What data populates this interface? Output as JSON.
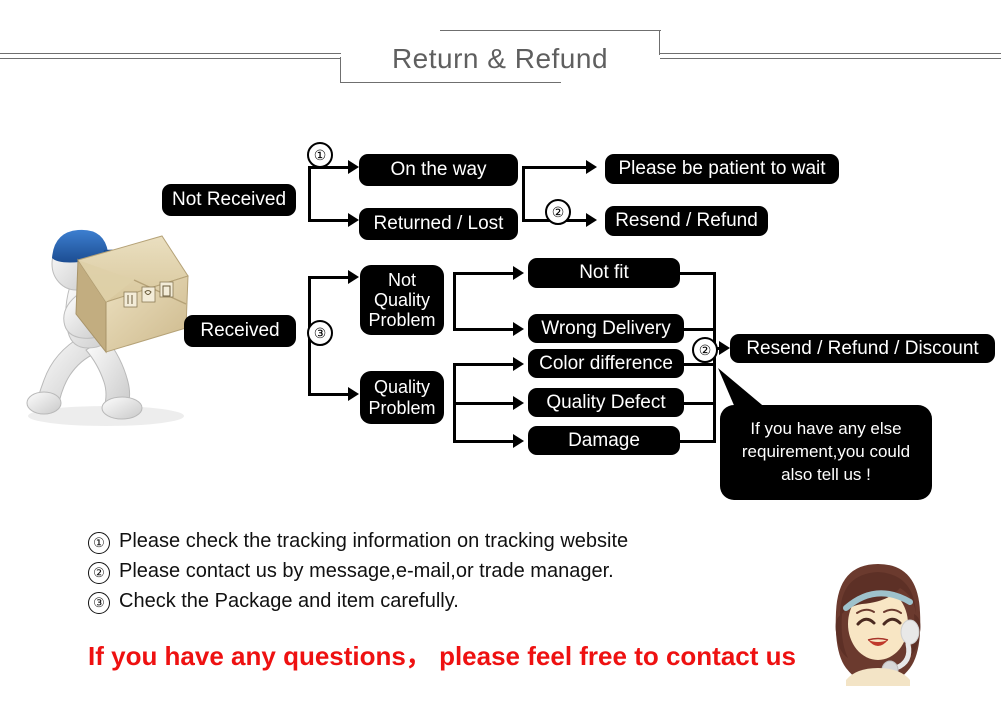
{
  "header": {
    "title": "Return & Refund"
  },
  "flow": {
    "not_received": "Not Received",
    "on_the_way": "On the way",
    "returned_lost": "Returned / Lost",
    "please_wait": "Please be patient to wait",
    "resend_refund": "Resend / Refund",
    "received": "Received",
    "not_quality_problem": "Not\nQuality\nProblem",
    "quality_problem": "Quality\nProblem",
    "not_fit": "Not fit",
    "wrong_delivery": "Wrong Delivery",
    "color_difference": "Color difference",
    "quality_defect": "Quality Defect",
    "damage": "Damage",
    "final_outcome": "Resend / Refund / Discount",
    "bubble": "If you have any else requirement,you could also tell us !",
    "marker_1": "①",
    "marker_2": "②",
    "marker_3": "③",
    "marker_2b": "②",
    "marker_2c": "②"
  },
  "notes": [
    {
      "num": "①",
      "text": "Please check the tracking information on tracking website"
    },
    {
      "num": "②",
      "text": "Please contact us by message,e-mail,or trade manager."
    },
    {
      "num": "③",
      "text": "Check the Package and item carefully."
    }
  ],
  "cta": "If you have any questions，  please feel free to contact us",
  "illustrations": {
    "courier": "running-courier-with-box",
    "agent": "customer-service-agent-headset"
  },
  "colors": {
    "box_fill": "#000000",
    "box_text": "#ffffff",
    "cta_red": "#ee1111",
    "header_gray": "#5f5f5f",
    "cap_blue": "#2a63b0",
    "carton": "#e3d3ac",
    "hair_brown": "#6b3a2e",
    "skin": "#f6e2bf"
  }
}
